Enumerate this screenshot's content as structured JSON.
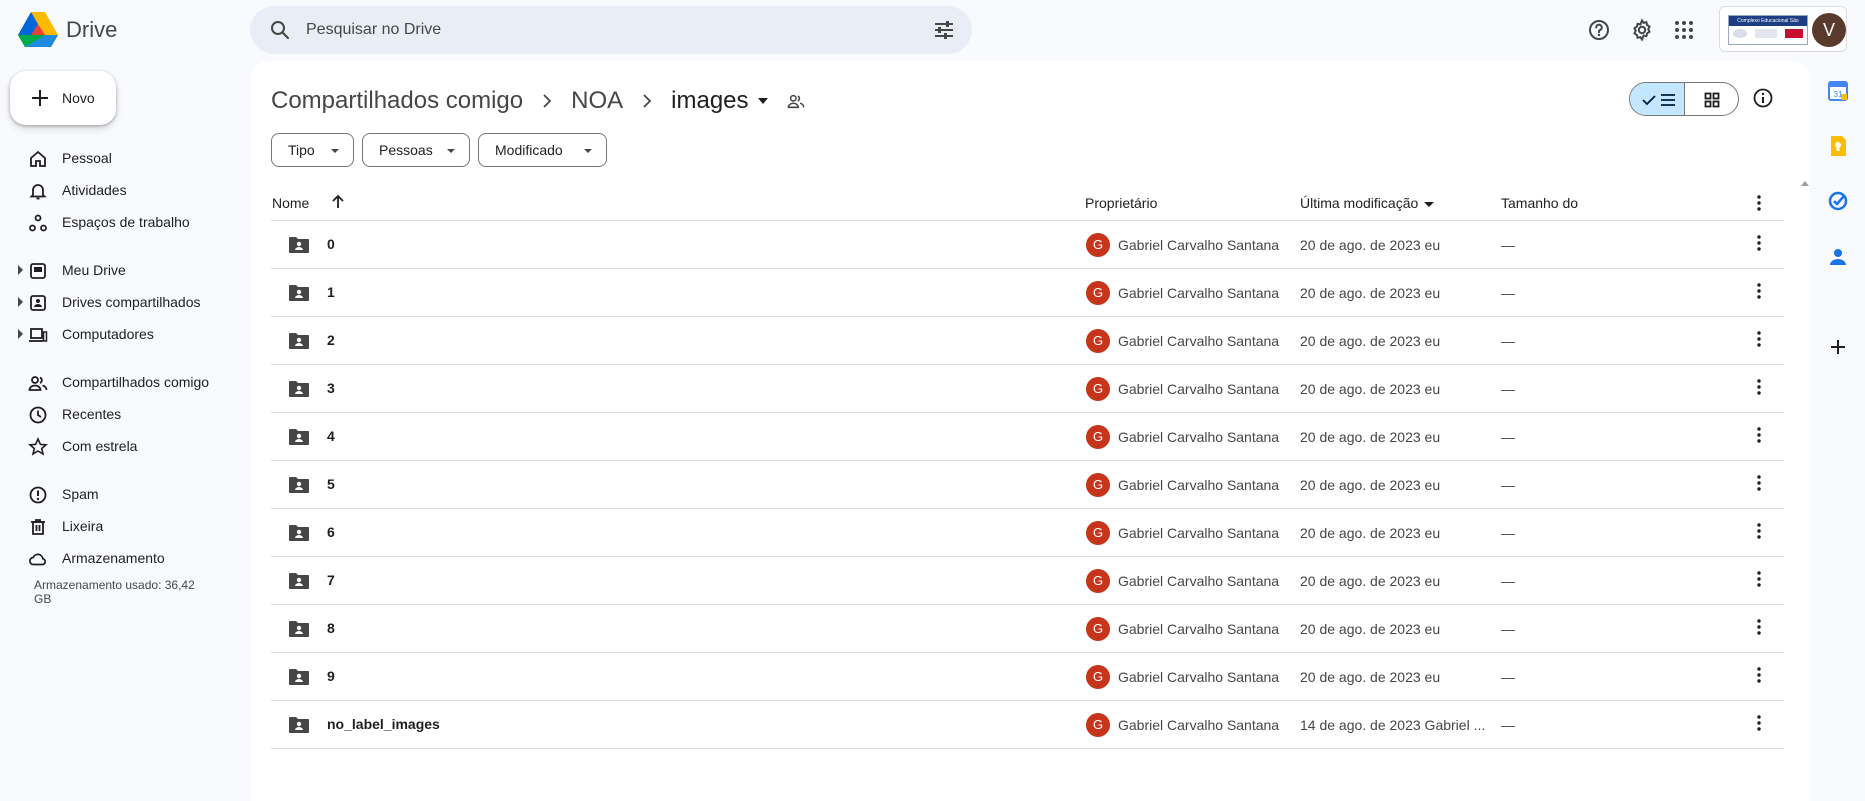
{
  "app": {
    "name": "Drive",
    "avatar_letter": "V"
  },
  "search": {
    "placeholder": "Pesquisar no Drive"
  },
  "brand": {
    "line": "Complexo Educacional São Leopoldo"
  },
  "sidebar": {
    "new_label": "Novo",
    "items": [
      {
        "label": "Pessoal",
        "icon": "home-icon"
      },
      {
        "label": "Atividades",
        "icon": "bell-icon"
      },
      {
        "label": "Espaços de trabalho",
        "icon": "workspaces-icon"
      },
      {
        "label": "Meu Drive",
        "icon": "my-drive-icon"
      },
      {
        "label": "Drives compartilhados",
        "icon": "shared-drives-icon"
      },
      {
        "label": "Computadores",
        "icon": "computers-icon"
      },
      {
        "label": "Compartilhados comigo",
        "icon": "people-icon"
      },
      {
        "label": "Recentes",
        "icon": "clock-icon"
      },
      {
        "label": "Com estrela",
        "icon": "star-icon"
      },
      {
        "label": "Spam",
        "icon": "spam-icon"
      },
      {
        "label": "Lixeira",
        "icon": "trash-icon"
      },
      {
        "label": "Armazenamento",
        "icon": "cloud-icon"
      }
    ],
    "storage_text": "Armazenamento usado: 36,42 GB"
  },
  "breadcrumb": {
    "items": [
      "Compartilhados comigo",
      "NOA"
    ],
    "current": "images"
  },
  "filters": [
    "Tipo",
    "Pessoas",
    "Modificado"
  ],
  "table": {
    "columns": {
      "name": "Nome",
      "owner": "Proprietário",
      "modified": "Última modificação",
      "size": "Tamanho do"
    },
    "rows": [
      {
        "name": "0",
        "owner_initial": "G",
        "owner": "Gabriel Carvalho Santana",
        "modified": "20 de ago. de 2023 eu",
        "size": "—"
      },
      {
        "name": "1",
        "owner_initial": "G",
        "owner": "Gabriel Carvalho Santana",
        "modified": "20 de ago. de 2023 eu",
        "size": "—"
      },
      {
        "name": "2",
        "owner_initial": "G",
        "owner": "Gabriel Carvalho Santana",
        "modified": "20 de ago. de 2023 eu",
        "size": "—"
      },
      {
        "name": "3",
        "owner_initial": "G",
        "owner": "Gabriel Carvalho Santana",
        "modified": "20 de ago. de 2023 eu",
        "size": "—"
      },
      {
        "name": "4",
        "owner_initial": "G",
        "owner": "Gabriel Carvalho Santana",
        "modified": "20 de ago. de 2023 eu",
        "size": "—"
      },
      {
        "name": "5",
        "owner_initial": "G",
        "owner": "Gabriel Carvalho Santana",
        "modified": "20 de ago. de 2023 eu",
        "size": "—"
      },
      {
        "name": "6",
        "owner_initial": "G",
        "owner": "Gabriel Carvalho Santana",
        "modified": "20 de ago. de 2023 eu",
        "size": "—"
      },
      {
        "name": "7",
        "owner_initial": "G",
        "owner": "Gabriel Carvalho Santana",
        "modified": "20 de ago. de 2023 eu",
        "size": "—"
      },
      {
        "name": "8",
        "owner_initial": "G",
        "owner": "Gabriel Carvalho Santana",
        "modified": "20 de ago. de 2023 eu",
        "size": "—"
      },
      {
        "name": "9",
        "owner_initial": "G",
        "owner": "Gabriel Carvalho Santana",
        "modified": "20 de ago. de 2023 eu",
        "size": "—"
      },
      {
        "name": "no_label_images",
        "owner_initial": "G",
        "owner": "Gabriel Carvalho Santana",
        "modified": "14 de ago. de 2023 Gabriel ...",
        "size": "—"
      }
    ]
  },
  "colors": {
    "accent": "#0b57d0",
    "selected_toggle": "#c2e7ff",
    "owner_avatar": "#c5341b"
  }
}
